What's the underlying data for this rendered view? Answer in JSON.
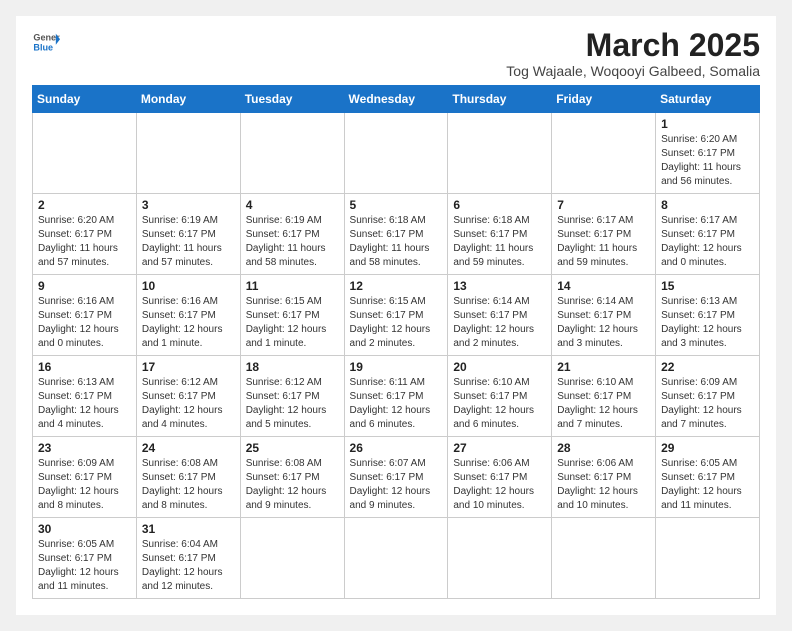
{
  "header": {
    "logo_line1": "General",
    "logo_line2": "Blue",
    "month_title": "March 2025",
    "location": "Tog Wajaale, Woqooyi Galbeed, Somalia"
  },
  "weekdays": [
    "Sunday",
    "Monday",
    "Tuesday",
    "Wednesday",
    "Thursday",
    "Friday",
    "Saturday"
  ],
  "weeks": [
    [
      {
        "day": "",
        "info": ""
      },
      {
        "day": "",
        "info": ""
      },
      {
        "day": "",
        "info": ""
      },
      {
        "day": "",
        "info": ""
      },
      {
        "day": "",
        "info": ""
      },
      {
        "day": "",
        "info": ""
      },
      {
        "day": "1",
        "info": "Sunrise: 6:20 AM\nSunset: 6:17 PM\nDaylight: 11 hours\nand 56 minutes."
      }
    ],
    [
      {
        "day": "2",
        "info": "Sunrise: 6:20 AM\nSunset: 6:17 PM\nDaylight: 11 hours\nand 57 minutes."
      },
      {
        "day": "3",
        "info": "Sunrise: 6:19 AM\nSunset: 6:17 PM\nDaylight: 11 hours\nand 57 minutes."
      },
      {
        "day": "4",
        "info": "Sunrise: 6:19 AM\nSunset: 6:17 PM\nDaylight: 11 hours\nand 58 minutes."
      },
      {
        "day": "5",
        "info": "Sunrise: 6:18 AM\nSunset: 6:17 PM\nDaylight: 11 hours\nand 58 minutes."
      },
      {
        "day": "6",
        "info": "Sunrise: 6:18 AM\nSunset: 6:17 PM\nDaylight: 11 hours\nand 59 minutes."
      },
      {
        "day": "7",
        "info": "Sunrise: 6:17 AM\nSunset: 6:17 PM\nDaylight: 11 hours\nand 59 minutes."
      },
      {
        "day": "8",
        "info": "Sunrise: 6:17 AM\nSunset: 6:17 PM\nDaylight: 12 hours\nand 0 minutes."
      }
    ],
    [
      {
        "day": "9",
        "info": "Sunrise: 6:16 AM\nSunset: 6:17 PM\nDaylight: 12 hours\nand 0 minutes."
      },
      {
        "day": "10",
        "info": "Sunrise: 6:16 AM\nSunset: 6:17 PM\nDaylight: 12 hours\nand 1 minute."
      },
      {
        "day": "11",
        "info": "Sunrise: 6:15 AM\nSunset: 6:17 PM\nDaylight: 12 hours\nand 1 minute."
      },
      {
        "day": "12",
        "info": "Sunrise: 6:15 AM\nSunset: 6:17 PM\nDaylight: 12 hours\nand 2 minutes."
      },
      {
        "day": "13",
        "info": "Sunrise: 6:14 AM\nSunset: 6:17 PM\nDaylight: 12 hours\nand 2 minutes."
      },
      {
        "day": "14",
        "info": "Sunrise: 6:14 AM\nSunset: 6:17 PM\nDaylight: 12 hours\nand 3 minutes."
      },
      {
        "day": "15",
        "info": "Sunrise: 6:13 AM\nSunset: 6:17 PM\nDaylight: 12 hours\nand 3 minutes."
      }
    ],
    [
      {
        "day": "16",
        "info": "Sunrise: 6:13 AM\nSunset: 6:17 PM\nDaylight: 12 hours\nand 4 minutes."
      },
      {
        "day": "17",
        "info": "Sunrise: 6:12 AM\nSunset: 6:17 PM\nDaylight: 12 hours\nand 4 minutes."
      },
      {
        "day": "18",
        "info": "Sunrise: 6:12 AM\nSunset: 6:17 PM\nDaylight: 12 hours\nand 5 minutes."
      },
      {
        "day": "19",
        "info": "Sunrise: 6:11 AM\nSunset: 6:17 PM\nDaylight: 12 hours\nand 6 minutes."
      },
      {
        "day": "20",
        "info": "Sunrise: 6:10 AM\nSunset: 6:17 PM\nDaylight: 12 hours\nand 6 minutes."
      },
      {
        "day": "21",
        "info": "Sunrise: 6:10 AM\nSunset: 6:17 PM\nDaylight: 12 hours\nand 7 minutes."
      },
      {
        "day": "22",
        "info": "Sunrise: 6:09 AM\nSunset: 6:17 PM\nDaylight: 12 hours\nand 7 minutes."
      }
    ],
    [
      {
        "day": "23",
        "info": "Sunrise: 6:09 AM\nSunset: 6:17 PM\nDaylight: 12 hours\nand 8 minutes."
      },
      {
        "day": "24",
        "info": "Sunrise: 6:08 AM\nSunset: 6:17 PM\nDaylight: 12 hours\nand 8 minutes."
      },
      {
        "day": "25",
        "info": "Sunrise: 6:08 AM\nSunset: 6:17 PM\nDaylight: 12 hours\nand 9 minutes."
      },
      {
        "day": "26",
        "info": "Sunrise: 6:07 AM\nSunset: 6:17 PM\nDaylight: 12 hours\nand 9 minutes."
      },
      {
        "day": "27",
        "info": "Sunrise: 6:06 AM\nSunset: 6:17 PM\nDaylight: 12 hours\nand 10 minutes."
      },
      {
        "day": "28",
        "info": "Sunrise: 6:06 AM\nSunset: 6:17 PM\nDaylight: 12 hours\nand 10 minutes."
      },
      {
        "day": "29",
        "info": "Sunrise: 6:05 AM\nSunset: 6:17 PM\nDaylight: 12 hours\nand 11 minutes."
      }
    ],
    [
      {
        "day": "30",
        "info": "Sunrise: 6:05 AM\nSunset: 6:17 PM\nDaylight: 12 hours\nand 11 minutes."
      },
      {
        "day": "31",
        "info": "Sunrise: 6:04 AM\nSunset: 6:17 PM\nDaylight: 12 hours\nand 12 minutes."
      },
      {
        "day": "",
        "info": ""
      },
      {
        "day": "",
        "info": ""
      },
      {
        "day": "",
        "info": ""
      },
      {
        "day": "",
        "info": ""
      },
      {
        "day": "",
        "info": ""
      }
    ]
  ]
}
